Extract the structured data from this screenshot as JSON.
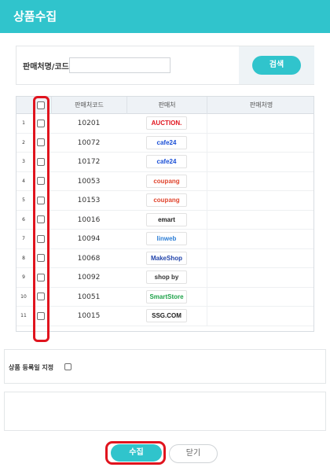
{
  "header": {
    "title": "상품수집"
  },
  "search": {
    "label": "판매처명/코드",
    "value": "",
    "button_label": "검색"
  },
  "grid": {
    "columns": {
      "code": "판매처코드",
      "seller": "판매처",
      "seller_name": "판매처명"
    },
    "rows": [
      {
        "num": "1",
        "code": "10201",
        "logo_text": "AUCTION.",
        "logo_color": "#e0141e"
      },
      {
        "num": "2",
        "code": "10072",
        "logo_text": "cafe24",
        "logo_color": "#1a4fd6"
      },
      {
        "num": "3",
        "code": "10172",
        "logo_text": "cafe24",
        "logo_color": "#1a4fd6"
      },
      {
        "num": "4",
        "code": "10053",
        "logo_text": "coupang",
        "logo_color": "#e0452e"
      },
      {
        "num": "5",
        "code": "10153",
        "logo_text": "coupang",
        "logo_color": "#e0452e"
      },
      {
        "num": "6",
        "code": "10016",
        "logo_text": "emart",
        "logo_color": "#222222"
      },
      {
        "num": "7",
        "code": "10094",
        "logo_text": "linweb",
        "logo_color": "#2e7fd6"
      },
      {
        "num": "8",
        "code": "10068",
        "logo_text": "MakeShop",
        "logo_color": "#2244aa"
      },
      {
        "num": "9",
        "code": "10092",
        "logo_text": "shop by",
        "logo_color": "#333333"
      },
      {
        "num": "10",
        "code": "10051",
        "logo_text": "SmartStore",
        "logo_color": "#1fa34a"
      },
      {
        "num": "11",
        "code": "10015",
        "logo_text": "SSG.COM",
        "logo_color": "#222222"
      }
    ]
  },
  "date_option": {
    "label": "상품 등록일 지정",
    "checked": false
  },
  "footer": {
    "collect_label": "수집",
    "close_label": "닫기"
  }
}
